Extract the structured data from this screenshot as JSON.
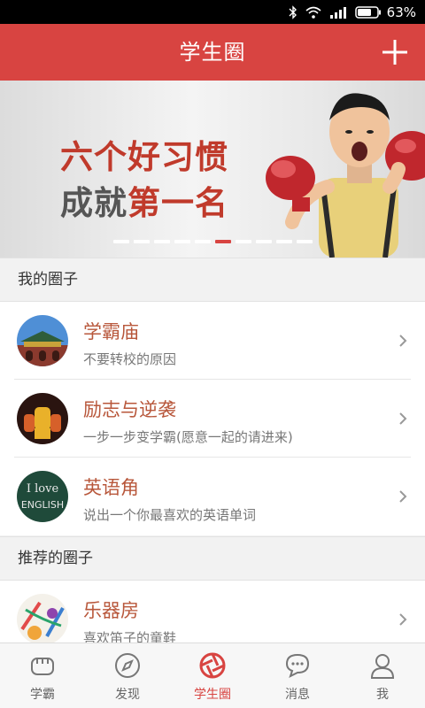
{
  "status_bar": {
    "battery_text": "63%"
  },
  "header": {
    "title": "学生圈",
    "add_icon": "plus-icon"
  },
  "banner": {
    "line1": "六个好习惯",
    "line2_part1": "成就",
    "line2_part2": "第一名",
    "slides_total": 10,
    "active_slide": 5
  },
  "my_circles": {
    "title": "我的圈子",
    "items": [
      {
        "name": "学霸庙",
        "desc": "不要转校的原因"
      },
      {
        "name": "励志与逆袭",
        "desc": "一步一步变学霸(愿意一起的请进来)"
      },
      {
        "name": "英语角",
        "desc": "说出一个你最喜欢的英语单词"
      }
    ]
  },
  "recommended_circles": {
    "title": "推荐的圈子",
    "items": [
      {
        "name": "乐器房",
        "desc": "喜欢笛子的童鞋"
      }
    ]
  },
  "avatar_english_text": {
    "line1": "I love",
    "line2": "ENGLISH"
  },
  "tabs": [
    {
      "label": "学霸",
      "icon": "fist-icon"
    },
    {
      "label": "发现",
      "icon": "compass-icon"
    },
    {
      "label": "学生圈",
      "icon": "aperture-icon",
      "active": true
    },
    {
      "label": "消息",
      "icon": "chat-icon"
    },
    {
      "label": "我",
      "icon": "user-icon"
    }
  ],
  "colors": {
    "accent": "#d84441",
    "item_title": "#b8573b"
  }
}
